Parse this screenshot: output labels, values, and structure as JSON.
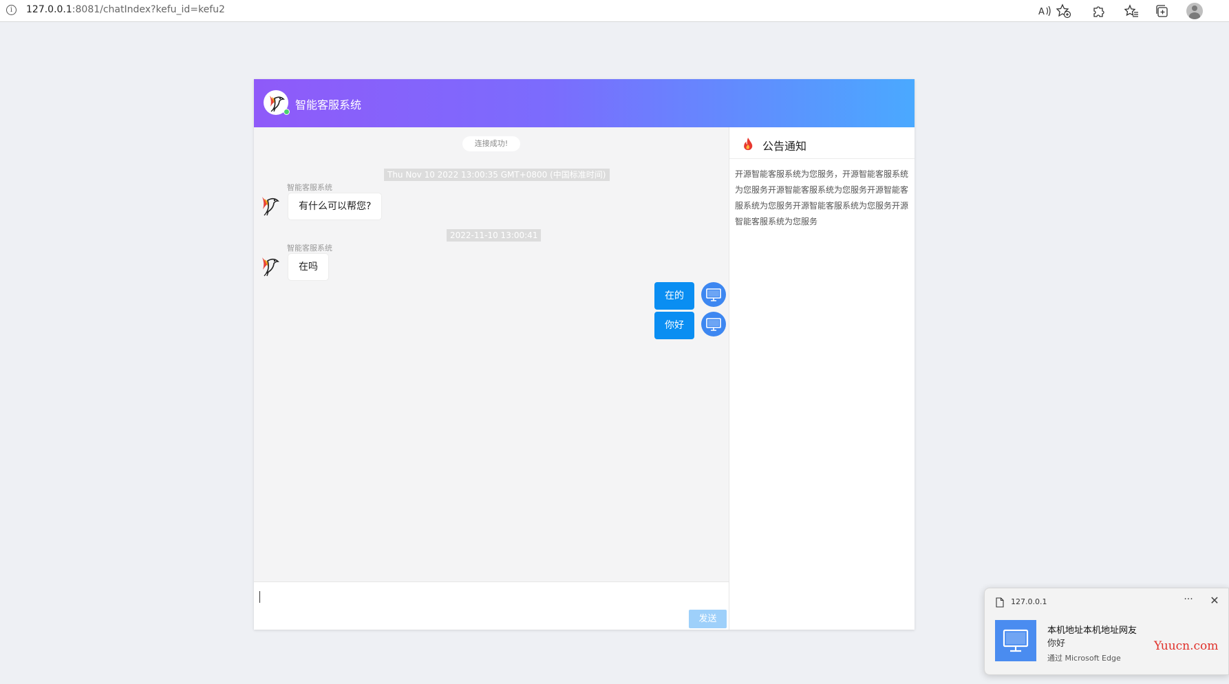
{
  "browser": {
    "url_host": "127.0.0.1",
    "url_rest": ":8081/chatIndex?kefu_id=kefu2",
    "icons": [
      "info-icon",
      "read-aloud-icon",
      "favorite-add-icon",
      "extensions-icon",
      "favorites-icon",
      "collections-icon",
      "profile-icon"
    ]
  },
  "header": {
    "title": "智能客服系统"
  },
  "messages": {
    "system_notice": "连接成功!",
    "items": [
      {
        "type": "timestamp",
        "text": "Thu Nov 10 2022 13:00:35 GMT+0800 (中国标准时间)"
      },
      {
        "type": "incoming",
        "sender": "智能客服系统",
        "text": "有什么可以帮您?"
      },
      {
        "type": "timestamp",
        "text": "2022-11-10 13:00:41"
      },
      {
        "type": "incoming",
        "sender": "智能客服系统",
        "text": "在吗"
      },
      {
        "type": "outgoing",
        "text": "在的"
      },
      {
        "type": "outgoing",
        "text": "你好"
      }
    ]
  },
  "input": {
    "value": "",
    "send_label": "发送"
  },
  "notice": {
    "title": "公告通知",
    "body": "开源智能客服系统为您服务，开源智能客服系统为您服务开源智能客服系统为您服务开源智能客服系统为您服务开源智能客服系统为您服务开源智能客服系统为您服务"
  },
  "toast": {
    "origin": "127.0.0.1",
    "more": "···",
    "close": "✕",
    "title": "本机地址本机地址网友",
    "body": "你好",
    "via": "通过 Microsoft Edge"
  },
  "watermark": "Yuucn.com",
  "colors": {
    "header_gradient_start": "#8f5af9",
    "header_gradient_end": "#4aa9ff",
    "outgoing_bubble": "#0a8ef2",
    "send_button": "#9ed0fa",
    "online_status": "#4ad36d",
    "watermark": "#e0302a"
  }
}
